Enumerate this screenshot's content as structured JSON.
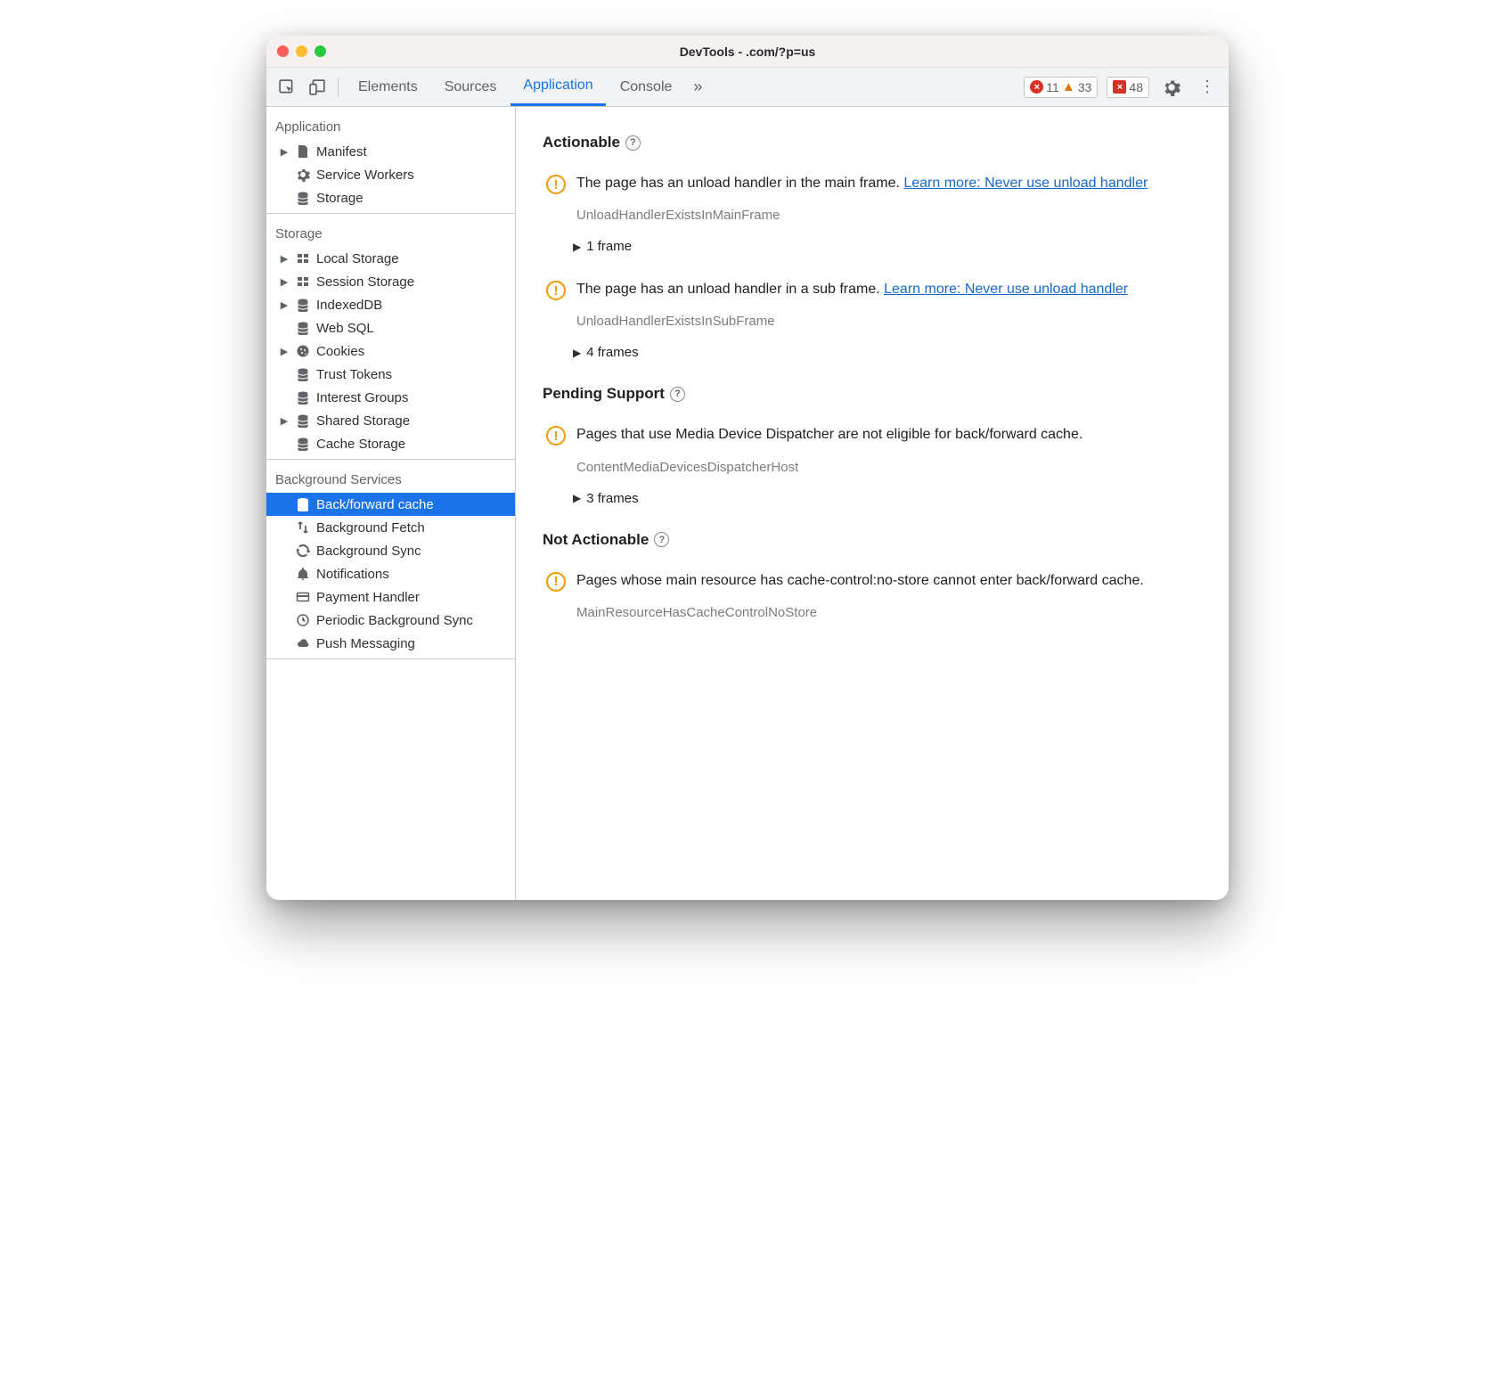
{
  "window": {
    "title": "DevTools -             .com/?p=us"
  },
  "toolbar": {
    "tabs": [
      "Elements",
      "Sources",
      "Application",
      "Console"
    ],
    "active_tab_index": 2,
    "error_count": "11",
    "warning_count": "33",
    "issue_count": "48"
  },
  "sidebar": {
    "sections": [
      {
        "heading": "Application",
        "items": [
          {
            "label": "Manifest",
            "icon": "file",
            "expandable": true
          },
          {
            "label": "Service Workers",
            "icon": "gear",
            "expandable": false
          },
          {
            "label": "Storage",
            "icon": "db",
            "expandable": false
          }
        ]
      },
      {
        "heading": "Storage",
        "items": [
          {
            "label": "Local Storage",
            "icon": "grid",
            "expandable": true
          },
          {
            "label": "Session Storage",
            "icon": "grid",
            "expandable": true
          },
          {
            "label": "IndexedDB",
            "icon": "db",
            "expandable": true
          },
          {
            "label": "Web SQL",
            "icon": "db",
            "expandable": false
          },
          {
            "label": "Cookies",
            "icon": "cookie",
            "expandable": true
          },
          {
            "label": "Trust Tokens",
            "icon": "db",
            "expandable": false
          },
          {
            "label": "Interest Groups",
            "icon": "db",
            "expandable": false
          },
          {
            "label": "Shared Storage",
            "icon": "db",
            "expandable": true
          },
          {
            "label": "Cache Storage",
            "icon": "db",
            "expandable": false
          }
        ]
      },
      {
        "heading": "Background Services",
        "items": [
          {
            "label": "Back/forward cache",
            "icon": "db",
            "expandable": false,
            "selected": true
          },
          {
            "label": "Background Fetch",
            "icon": "fetch",
            "expandable": false
          },
          {
            "label": "Background Sync",
            "icon": "sync",
            "expandable": false
          },
          {
            "label": "Notifications",
            "icon": "bell",
            "expandable": false
          },
          {
            "label": "Payment Handler",
            "icon": "card",
            "expandable": false
          },
          {
            "label": "Periodic Background Sync",
            "icon": "clock",
            "expandable": false
          },
          {
            "label": "Push Messaging",
            "icon": "cloud",
            "expandable": false
          }
        ]
      }
    ]
  },
  "main": {
    "sections": [
      {
        "heading": "Actionable",
        "issues": [
          {
            "text": "The page has an unload handler in the main frame. ",
            "link": "Learn more: Never use unload handler",
            "code": "UnloadHandlerExistsInMainFrame",
            "frames": "1 frame"
          },
          {
            "text": "The page has an unload handler in a sub frame. ",
            "link": "Learn more: Never use unload handler",
            "code": "UnloadHandlerExistsInSubFrame",
            "frames": "4 frames"
          }
        ]
      },
      {
        "heading": "Pending Support",
        "issues": [
          {
            "text": "Pages that use Media Device Dispatcher are not eligible for back/forward cache.",
            "link": "",
            "code": "ContentMediaDevicesDispatcherHost",
            "frames": "3 frames"
          }
        ]
      },
      {
        "heading": "Not Actionable",
        "issues": [
          {
            "text": "Pages whose main resource has cache-control:no-store cannot enter back/forward cache.",
            "link": "",
            "code": "MainResourceHasCacheControlNoStore",
            "frames": ""
          }
        ]
      }
    ]
  }
}
